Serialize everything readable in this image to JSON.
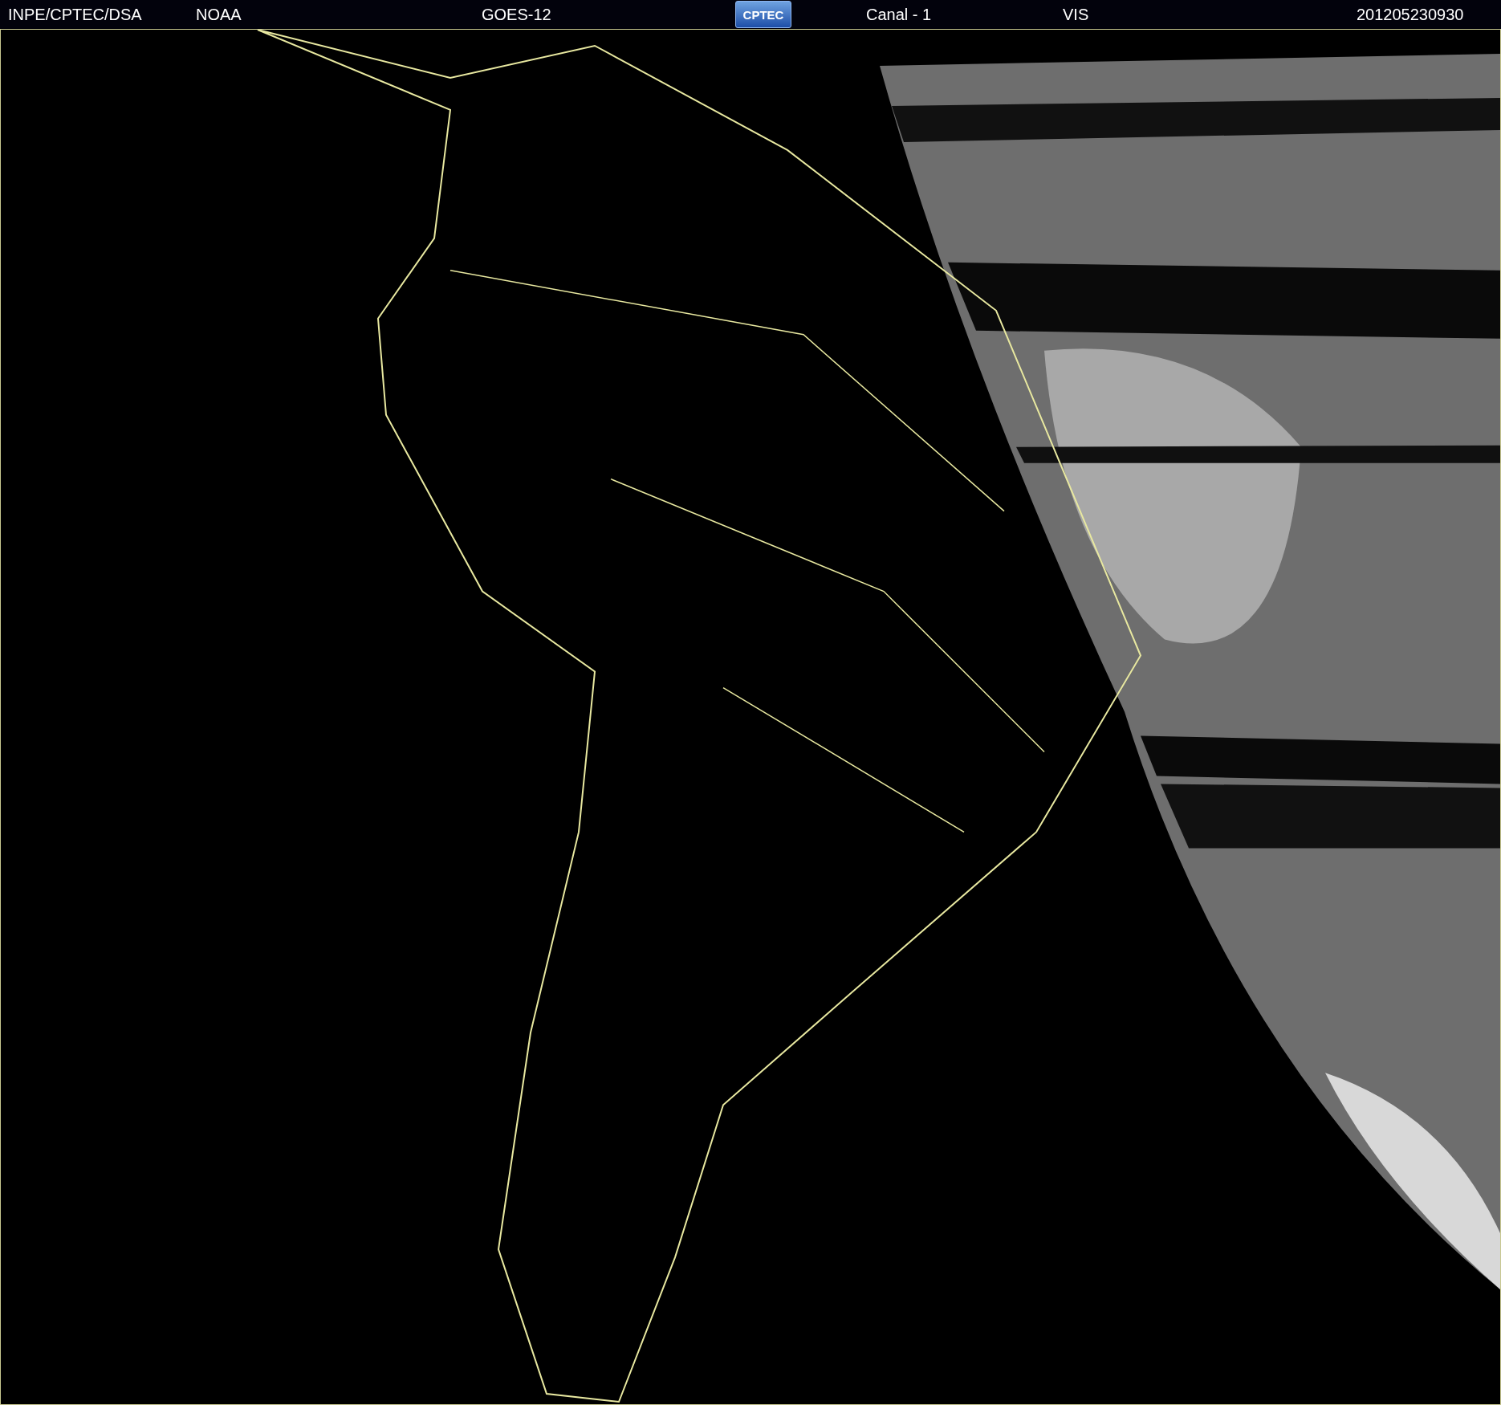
{
  "header": {
    "items": [
      {
        "kind": "text",
        "label": "INPE/CPTEC/DSA"
      },
      {
        "kind": "text",
        "label": "NOAA"
      },
      {
        "kind": "text",
        "label": "GOES-12"
      },
      {
        "kind": "logo",
        "label": "CPTEC"
      },
      {
        "kind": "text",
        "label": "Canal - 1"
      },
      {
        "kind": "text",
        "label": "VIS"
      },
      {
        "kind": "text",
        "label": "201205230930"
      }
    ]
  }
}
